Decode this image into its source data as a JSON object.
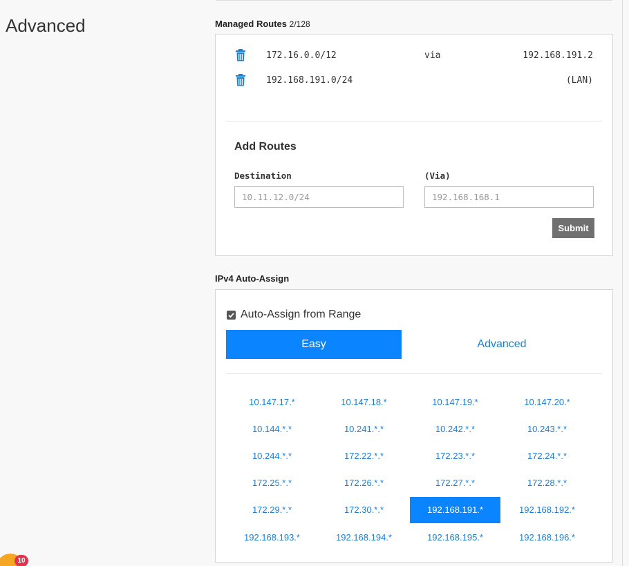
{
  "page": {
    "title": "Advanced"
  },
  "managed_routes": {
    "label": "Managed Routes",
    "count": "2/128",
    "routes": [
      {
        "destination": "172.16.0.0/12",
        "via_label": "via",
        "target": "192.168.191.2"
      },
      {
        "destination": "192.168.191.0/24",
        "via_label": "",
        "target": "(LAN)"
      }
    ],
    "add": {
      "title": "Add Routes",
      "destination_label": "Destination",
      "destination_placeholder": "10.11.12.0/24",
      "via_label": "(Via)",
      "via_placeholder": "192.168.168.1",
      "submit_label": "Submit"
    }
  },
  "ipv4": {
    "label": "IPv4 Auto-Assign",
    "checkbox_label": "Auto-Assign from Range",
    "checkbox_checked": true,
    "tabs": [
      {
        "label": "Easy",
        "active": true
      },
      {
        "label": "Advanced",
        "active": false
      }
    ],
    "ranges": [
      "10.147.17.*",
      "10.147.18.*",
      "10.147.19.*",
      "10.147.20.*",
      "10.144.*.*",
      "10.241.*.*",
      "10.242.*.*",
      "10.243.*.*",
      "10.244.*.*",
      "172.22.*.*",
      "172.23.*.*",
      "172.24.*.*",
      "172.25.*.*",
      "172.26.*.*",
      "172.27.*.*",
      "172.28.*.*",
      "172.29.*.*",
      "172.30.*.*",
      "192.168.191.*",
      "192.168.192.*",
      "192.168.193.*",
      "192.168.194.*",
      "192.168.195.*",
      "192.168.196.*"
    ],
    "selected_range": "192.168.191.*"
  },
  "notification": {
    "count": "10"
  },
  "colors": {
    "accent": "#0a84ff",
    "link": "#1a7fd6",
    "trash": "#1a7fd6",
    "badge": "#e0334c"
  }
}
